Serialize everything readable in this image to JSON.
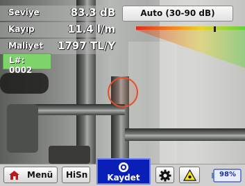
{
  "readings": [
    {
      "label": "Seviye",
      "value": "83.3 dB"
    },
    {
      "label": "Kayıp",
      "value": "11.4 l/m"
    },
    {
      "label": "Maliyet",
      "value": "1797 TL/Y"
    }
  ],
  "location_tag": "L#: 0002",
  "range_button": "Auto (30-90 dB)",
  "level_meter": {
    "level_fraction": 0.72
  },
  "toolbar": {
    "menu_label": "Menü",
    "hisn_label": "HiSn",
    "save_label": "Kaydet",
    "battery_label": "98%"
  },
  "icons": [
    "home-icon",
    "record-icon",
    "gear-icon",
    "warning-icon",
    "battery-icon"
  ],
  "colors": {
    "save_bg": "#0a1fb8",
    "location_bg": "#7ed36a",
    "target_ring": "#e0502c"
  }
}
